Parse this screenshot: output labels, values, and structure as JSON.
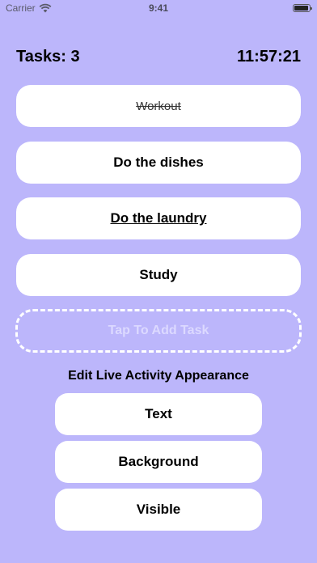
{
  "status_bar": {
    "carrier": "Carrier",
    "time": "9:41"
  },
  "header": {
    "task_count": "Tasks: 3",
    "timer": "11:57:21"
  },
  "tasks": [
    {
      "label": "Workout",
      "state": "completed"
    },
    {
      "label": "Do the dishes",
      "state": "normal"
    },
    {
      "label": "Do the laundry",
      "state": "active"
    },
    {
      "label": "Study",
      "state": "normal"
    }
  ],
  "add_task_label": "Tap To Add Task",
  "live_activity": {
    "title": "Edit Live Activity Appearance",
    "options": [
      "Text",
      "Background",
      "Visible"
    ]
  },
  "colors": {
    "background": "#bcb6fb",
    "card": "#ffffff",
    "add_task_border": "#ffffff"
  }
}
